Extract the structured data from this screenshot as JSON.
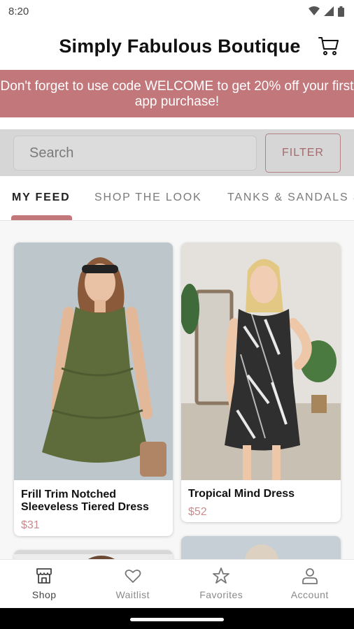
{
  "status_bar": {
    "time": "8:20",
    "icons": [
      "wifi-icon",
      "signal-icon",
      "battery-icon"
    ]
  },
  "header": {
    "title": "Simply Fabulous Boutique",
    "cart_icon": "cart-icon"
  },
  "promo": {
    "text": "Don't forget to use code WELCOME to get 20% off your first app purchase!"
  },
  "search": {
    "placeholder": "Search",
    "filter_label": "FILTER"
  },
  "tabs": [
    {
      "label": "MY FEED",
      "active": true
    },
    {
      "label": "SHOP THE LOOK",
      "active": false
    },
    {
      "label": "TANKS & SANDALS SU",
      "active": false
    }
  ],
  "products": [
    {
      "name": "Frill Trim Notched Sleeveless Tiered Dress",
      "price": "$31"
    },
    {
      "name": "Tropical Mind Dress",
      "price": "$52"
    }
  ],
  "bottom_nav": [
    {
      "label": "Shop",
      "icon": "shop-icon",
      "active": true
    },
    {
      "label": "Waitlist",
      "icon": "heart-icon",
      "active": false
    },
    {
      "label": "Favorites",
      "icon": "star-icon",
      "active": false
    },
    {
      "label": "Account",
      "icon": "account-icon",
      "active": false
    }
  ],
  "colors": {
    "accent": "#c2777b",
    "price": "#c98b8f",
    "search_bg": "#d6d6d6"
  }
}
